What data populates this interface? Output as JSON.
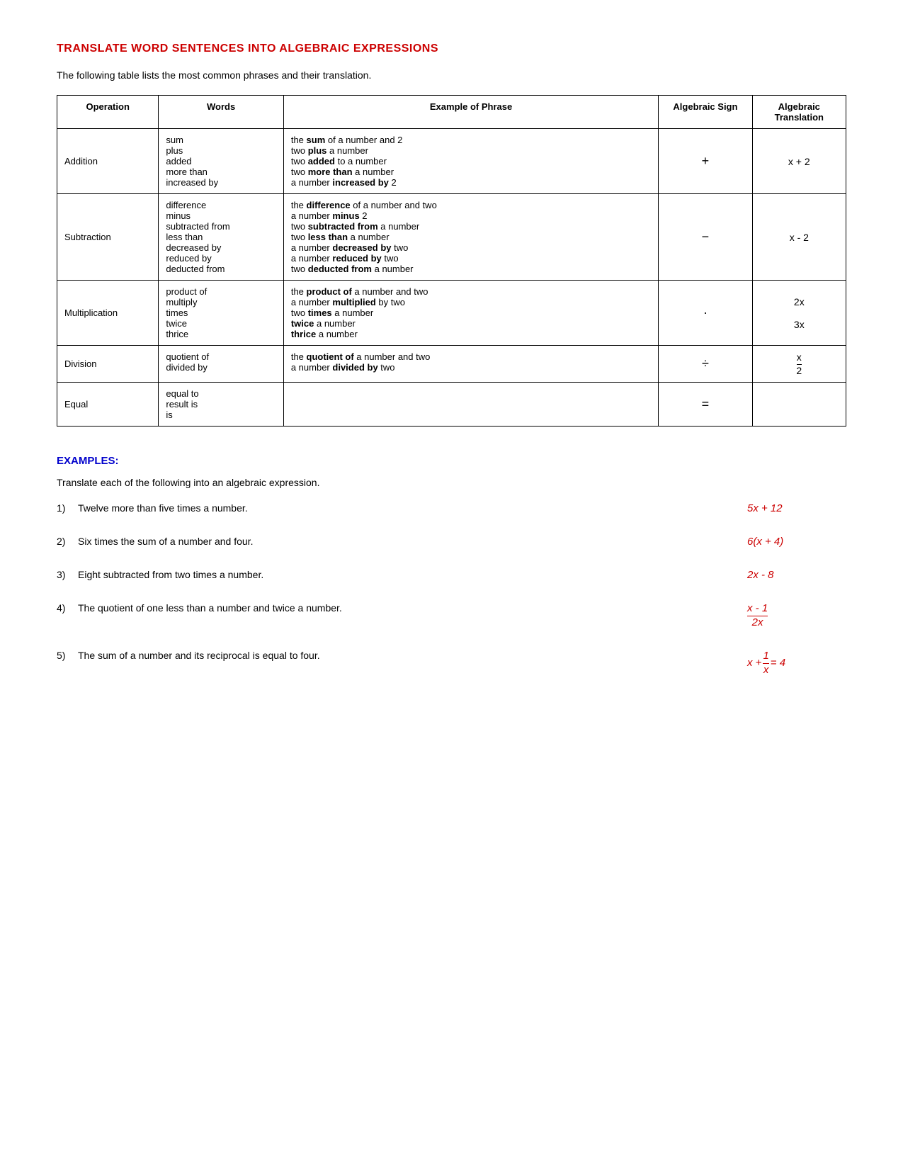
{
  "pageTitle": "TRANSLATE WORD SENTENCES INTO ALGEBRAIC EXPRESSIONS",
  "introText": "The following table lists the most common phrases and their translation.",
  "tableHeaders": {
    "operation": "Operation",
    "words": "Words",
    "phrase": "Example of Phrase",
    "sign": "Algebraic Sign",
    "translation": "Algebraic Translation"
  },
  "tableRows": [
    {
      "operation": "Addition",
      "words": [
        "sum",
        "plus",
        "added",
        "more than",
        "increased by"
      ],
      "phrases": [
        {
          "text_before": "the ",
          "bold": "sum",
          "text_after": " of a number and 2"
        },
        {
          "text_before": "two ",
          "bold": "plus",
          "text_after": " a number"
        },
        {
          "text_before": "two ",
          "bold": "added",
          "text_after": " to a number"
        },
        {
          "text_before": "two ",
          "bold": "more than",
          "text_after": " a number"
        },
        {
          "text_before": "a number ",
          "bold": "increased by",
          "text_after": " 2"
        }
      ],
      "sign": "+",
      "translation": "x + 2"
    },
    {
      "operation": "Subtraction",
      "words": [
        "difference",
        "minus",
        "subtracted from",
        "less than",
        "decreased by",
        "reduced by",
        "deducted from"
      ],
      "phrases": [
        {
          "text_before": "the ",
          "bold": "difference",
          "text_after": " of a number and two"
        },
        {
          "text_before": "a number ",
          "bold": "minus",
          "text_after": " 2"
        },
        {
          "text_before": "two ",
          "bold": "subtracted from",
          "text_after": " a number"
        },
        {
          "text_before": "two ",
          "bold": "less than",
          "text_after": " a number"
        },
        {
          "text_before": "a number ",
          "bold": "decreased by",
          "text_after": " two"
        },
        {
          "text_before": "a number ",
          "bold": "reduced by",
          "text_after": " two"
        },
        {
          "text_before": "two ",
          "bold": "deducted from",
          "text_after": " a number"
        }
      ],
      "sign": "−",
      "translation": "x - 2"
    },
    {
      "operation": "Multiplication",
      "words": [
        "product of",
        "multiply",
        "times",
        "twice",
        "thrice"
      ],
      "phrases": [
        {
          "text_before": "the ",
          "bold": "product of",
          "text_after": " a number and two"
        },
        {
          "text_before": "a number ",
          "bold": "multiplied",
          "text_after": " by two"
        },
        {
          "text_before": "two ",
          "bold": "times",
          "text_after": " a number"
        },
        {
          "text_before": "",
          "bold": "twice",
          "text_after": " a number"
        },
        {
          "text_before": "",
          "bold": "thrice",
          "text_after": " a number"
        }
      ],
      "sign": "·",
      "translation": "2x\n3x"
    },
    {
      "operation": "Division",
      "words": [
        "quotient of",
        "divided by"
      ],
      "phrases": [
        {
          "text_before": "the ",
          "bold": "quotient of",
          "text_after": " a number and two"
        },
        {
          "text_before": "a number ",
          "bold": "divided by",
          "text_after": " two"
        }
      ],
      "sign": "÷",
      "translation": "x/2"
    },
    {
      "operation": "Equal",
      "words": [
        "equal to",
        "result is",
        "is"
      ],
      "phrases": [],
      "sign": "=",
      "translation": ""
    }
  ],
  "examplesTitle": "EXAMPLES:",
  "examplesIntro": "Translate each of the following into an algebraic expression.",
  "examples": [
    {
      "num": "1)",
      "text": "Twelve more than five times a number.",
      "answer": "5x + 12",
      "type": "plain"
    },
    {
      "num": "2)",
      "text": "Six times the sum of a number and four.",
      "answer": "6(x + 4)",
      "type": "plain"
    },
    {
      "num": "3)",
      "text": "Eight subtracted from two times a number.",
      "answer": "2x - 8",
      "type": "plain"
    },
    {
      "num": "4)",
      "text": "The quotient of one less than a number and twice a number.",
      "answer_num": "x - 1",
      "answer_den": "2x",
      "type": "fraction"
    },
    {
      "num": "5)",
      "text": "The sum of  a number and its reciprocal is equal to four.",
      "answer_num": "1",
      "answer_den": "x",
      "answer_prefix": "x + ",
      "answer_suffix": " = 4",
      "type": "fraction-inline"
    }
  ]
}
